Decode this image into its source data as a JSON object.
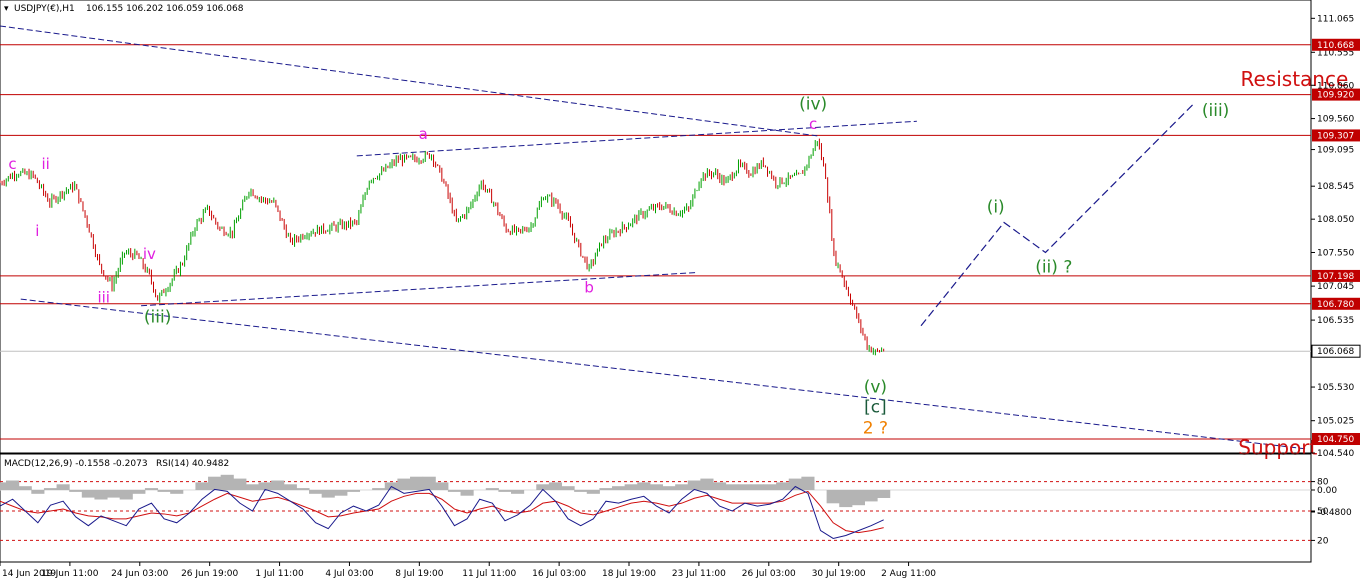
{
  "header": {
    "symbol": "USDJPY(€),H1",
    "ohlc": "106.155 106.202 106.059 106.068"
  },
  "indicator_header": {
    "macd_label": "MACD(12,26,9) -0.1558 -0.2073",
    "rsi_label": "RSI(14) 40.9482"
  },
  "colors": {
    "bull": "#00a000",
    "bear": "#c80000",
    "level_line": "#c00000",
    "trendline": "#1a1a8c",
    "magenta": "#e020e0",
    "green_label": "#2a8a2a",
    "orange": "#f08000",
    "resistance": "#d01010",
    "macd_hist": "#b4b4b4",
    "rsi_line": "#1a1a8c",
    "signal_line": "#d01010"
  },
  "chart_data": [
    {
      "type": "candlestick",
      "title": "USDJPY(€),H1",
      "ylim": [
        104.54,
        111.34
      ],
      "y_ticks": [
        "111.065",
        "110.555",
        "110.060",
        "109.560",
        "109.095",
        "108.545",
        "108.050",
        "107.550",
        "107.045",
        "106.535",
        "105.530",
        "105.025",
        "104.540"
      ],
      "x_ticks": [
        "14 Jun 2019",
        "19 Jun 11:00",
        "24 Jun 03:00",
        "26 Jun 19:00",
        "1 Jul 11:00",
        "4 Jul 03:00",
        "8 Jul 19:00",
        "11 Jul 11:00",
        "16 Jul 03:00",
        "18 Jul 19:00",
        "23 Jul 11:00",
        "26 Jul 03:00",
        "30 Jul 19:00",
        "2 Aug 11:00"
      ],
      "price_levels": [
        {
          "value": 110.668,
          "label": "110.668"
        },
        {
          "value": 109.92,
          "label": "109.920"
        },
        {
          "value": 109.307,
          "label": "109.307"
        },
        {
          "value": 107.198,
          "label": "107.198"
        },
        {
          "value": 106.78,
          "label": "106.780"
        },
        {
          "value": 104.75,
          "label": "104.750"
        }
      ],
      "current_price": {
        "value": 106.068,
        "label": "106.068"
      },
      "price_path": [
        {
          "x": 0,
          "y": 108.6
        },
        {
          "x": 4,
          "y": 108.75
        },
        {
          "x": 8,
          "y": 108.7
        },
        {
          "x": 12,
          "y": 108.3
        },
        {
          "x": 15,
          "y": 108.45
        },
        {
          "x": 18,
          "y": 108.55
        },
        {
          "x": 21,
          "y": 108.0
        },
        {
          "x": 24,
          "y": 107.35
        },
        {
          "x": 27,
          "y": 107.05
        },
        {
          "x": 30,
          "y": 107.55
        },
        {
          "x": 33,
          "y": 107.5
        },
        {
          "x": 36,
          "y": 107.2
        },
        {
          "x": 38,
          "y": 106.85
        },
        {
          "x": 41,
          "y": 107.1
        },
        {
          "x": 44,
          "y": 107.4
        },
        {
          "x": 47,
          "y": 107.95
        },
        {
          "x": 50,
          "y": 108.2
        },
        {
          "x": 53,
          "y": 107.9
        },
        {
          "x": 56,
          "y": 107.85
        },
        {
          "x": 60,
          "y": 108.5
        },
        {
          "x": 63,
          "y": 108.35
        },
        {
          "x": 66,
          "y": 108.3
        },
        {
          "x": 70,
          "y": 107.7
        },
        {
          "x": 74,
          "y": 107.85
        },
        {
          "x": 78,
          "y": 107.9
        },
        {
          "x": 82,
          "y": 107.95
        },
        {
          "x": 86,
          "y": 108.0
        },
        {
          "x": 89,
          "y": 108.65
        },
        {
          "x": 92,
          "y": 108.75
        },
        {
          "x": 96,
          "y": 108.95
        },
        {
          "x": 100,
          "y": 108.95
        },
        {
          "x": 104,
          "y": 109.02
        },
        {
          "x": 107,
          "y": 108.6
        },
        {
          "x": 110,
          "y": 108.0
        },
        {
          "x": 113,
          "y": 108.2
        },
        {
          "x": 116,
          "y": 108.6
        },
        {
          "x": 119,
          "y": 108.3
        },
        {
          "x": 122,
          "y": 107.9
        },
        {
          "x": 125,
          "y": 107.85
        },
        {
          "x": 128,
          "y": 107.95
        },
        {
          "x": 131,
          "y": 108.4
        },
        {
          "x": 134,
          "y": 108.3
        },
        {
          "x": 137,
          "y": 108.0
        },
        {
          "x": 140,
          "y": 107.55
        },
        {
          "x": 142,
          "y": 107.3
        },
        {
          "x": 145,
          "y": 107.7
        },
        {
          "x": 148,
          "y": 107.85
        },
        {
          "x": 151,
          "y": 107.95
        },
        {
          "x": 154,
          "y": 108.1
        },
        {
          "x": 157,
          "y": 108.2
        },
        {
          "x": 160,
          "y": 108.25
        },
        {
          "x": 163,
          "y": 108.15
        },
        {
          "x": 166,
          "y": 108.2
        },
        {
          "x": 169,
          "y": 108.7
        },
        {
          "x": 172,
          "y": 108.75
        },
        {
          "x": 175,
          "y": 108.6
        },
        {
          "x": 178,
          "y": 108.85
        },
        {
          "x": 181,
          "y": 108.75
        },
        {
          "x": 184,
          "y": 108.9
        },
        {
          "x": 187,
          "y": 108.6
        },
        {
          "x": 190,
          "y": 108.65
        },
        {
          "x": 193,
          "y": 108.7
        },
        {
          "x": 195,
          "y": 108.95
        },
        {
          "x": 197,
          "y": 109.25
        },
        {
          "x": 199,
          "y": 108.7
        },
        {
          "x": 201,
          "y": 107.5
        },
        {
          "x": 203,
          "y": 107.2
        },
        {
          "x": 205,
          "y": 106.85
        },
        {
          "x": 207,
          "y": 106.5
        },
        {
          "x": 209,
          "y": 106.15
        },
        {
          "x": 211,
          "y": 106.05
        },
        {
          "x": 213,
          "y": 106.1
        }
      ],
      "trendlines": [
        {
          "name": "upper channel",
          "from": {
            "x": 0,
            "y": 110.95
          },
          "to": {
            "x": 197,
            "y": 109.3
          }
        },
        {
          "name": "lower channel",
          "from": {
            "x": 5,
            "y": 106.85
          },
          "to": {
            "x": 315,
            "y": 104.6
          }
        },
        {
          "name": "inner line 1",
          "from": {
            "x": 34,
            "y": 106.75
          },
          "to": {
            "x": 168,
            "y": 107.25
          }
        },
        {
          "name": "inner line 2",
          "from": {
            "x": 86,
            "y": 109.0
          },
          "to": {
            "x": 221,
            "y": 109.52
          }
        }
      ],
      "projection": [
        {
          "x": 222,
          "y": 106.45
        },
        {
          "x": 242,
          "y": 108.0
        },
        {
          "x": 252,
          "y": 107.55
        },
        {
          "x": 288,
          "y": 109.8
        }
      ],
      "wave_labels": [
        {
          "text": "c",
          "x": 3,
          "y": 108.8,
          "color": "magenta"
        },
        {
          "text": "ii",
          "x": 11,
          "y": 108.8,
          "color": "magenta"
        },
        {
          "text": "i",
          "x": 9,
          "y": 107.8,
          "color": "magenta"
        },
        {
          "text": "iv",
          "x": 36,
          "y": 107.45,
          "color": "magenta"
        },
        {
          "text": "iii",
          "x": 25,
          "y": 106.8,
          "color": "magenta"
        },
        {
          "text": "(iii)",
          "x": 38,
          "y": 106.5,
          "color": "green"
        },
        {
          "text": "a",
          "x": 102,
          "y": 109.25,
          "color": "magenta"
        },
        {
          "text": "b",
          "x": 142,
          "y": 106.95,
          "color": "magenta"
        },
        {
          "text": "(iv)",
          "x": 196,
          "y": 109.7,
          "color": "green"
        },
        {
          "text": "c",
          "x": 196,
          "y": 109.4,
          "color": "magenta"
        },
        {
          "text": "(v)",
          "x": 211,
          "y": 105.45,
          "color": "green"
        },
        {
          "text": "[c]",
          "x": 211,
          "y": 105.15,
          "color": "darkgreen"
        },
        {
          "text": "2 ?",
          "x": 211,
          "y": 104.83,
          "color": "orange"
        },
        {
          "text": "(i)",
          "x": 240,
          "y": 108.15,
          "color": "green"
        },
        {
          "text": "(ii) ?",
          "x": 254,
          "y": 107.25,
          "color": "green"
        },
        {
          "text": "(iii)",
          "x": 293,
          "y": 109.6,
          "color": "green"
        }
      ],
      "annotations": [
        {
          "text": "Resistance",
          "x": 312,
          "y": 110.05
        },
        {
          "text": "Support",
          "x": 308,
          "y": 104.52
        }
      ]
    },
    {
      "type": "line",
      "title": "MACD(12,26,9) -0.1558 -0.2073 RSI(14) 40.9482",
      "y_ticks_right": [
        "80",
        "0.00",
        "50",
        "-0.4800",
        "20"
      ],
      "rsi_levels": [
        80,
        50,
        20
      ],
      "series": [
        {
          "name": "RSI(14)",
          "values": [
            55,
            62,
            50,
            38,
            56,
            60,
            44,
            35,
            45,
            40,
            35,
            52,
            58,
            42,
            38,
            48,
            62,
            72,
            70,
            58,
            50,
            72,
            68,
            60,
            52,
            38,
            32,
            48,
            55,
            50,
            56,
            75,
            68,
            70,
            72,
            55,
            35,
            42,
            62,
            58,
            40,
            46,
            56,
            72,
            60,
            42,
            35,
            42,
            60,
            58,
            62,
            65,
            55,
            48,
            62,
            72,
            68,
            55,
            50,
            58,
            55,
            57,
            62,
            75,
            68,
            30,
            22,
            25,
            30,
            35,
            41
          ]
        },
        {
          "name": "Signal",
          "values": [
            60,
            55,
            50,
            48,
            50,
            52,
            48,
            45,
            44,
            42,
            42,
            45,
            48,
            47,
            45,
            48,
            55,
            62,
            68,
            64,
            60,
            62,
            64,
            60,
            55,
            50,
            44,
            45,
            48,
            50,
            52,
            60,
            65,
            68,
            68,
            62,
            52,
            48,
            52,
            55,
            50,
            48,
            50,
            58,
            60,
            55,
            48,
            46,
            50,
            54,
            58,
            60,
            58,
            55,
            58,
            63,
            66,
            62,
            58,
            58,
            58,
            58,
            60,
            66,
            70,
            55,
            38,
            30,
            28,
            30,
            33
          ]
        },
        {
          "name": "MACD histogram",
          "values": [
            0.2,
            0.25,
            0.1,
            -0.1,
            0.05,
            0.15,
            -0.05,
            -0.2,
            -0.25,
            -0.2,
            -0.25,
            -0.1,
            0.05,
            -0.05,
            -0.1,
            0.0,
            0.2,
            0.35,
            0.4,
            0.3,
            0.15,
            0.2,
            0.25,
            0.15,
            0.05,
            -0.1,
            -0.2,
            -0.15,
            -0.05,
            0.0,
            0.05,
            0.2,
            0.3,
            0.35,
            0.35,
            0.2,
            -0.05,
            -0.15,
            0.0,
            0.05,
            -0.05,
            -0.1,
            0.0,
            0.15,
            0.2,
            0.1,
            -0.05,
            -0.1,
            0.05,
            0.1,
            0.15,
            0.2,
            0.15,
            0.1,
            0.15,
            0.25,
            0.3,
            0.2,
            0.15,
            0.15,
            0.15,
            0.15,
            0.2,
            0.3,
            0.35,
            0.0,
            -0.35,
            -0.45,
            -0.4,
            -0.3,
            -0.21
          ]
        }
      ]
    }
  ]
}
